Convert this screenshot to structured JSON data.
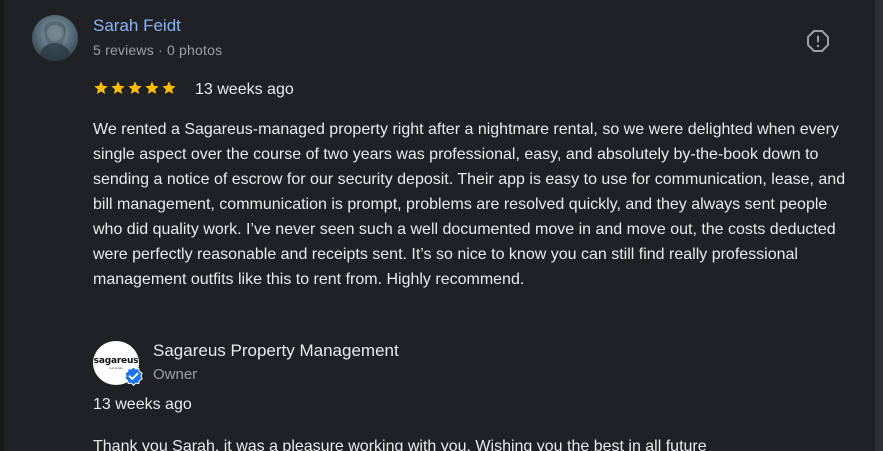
{
  "review": {
    "reviewer_name": "Sarah Feidt",
    "reviewer_meta": "5 reviews · 0 photos",
    "rating": 5,
    "rating_max": 5,
    "date": "13 weeks ago",
    "text": "We rented a Sagareus-managed property right after a nightmare rental, so we were delighted when every single aspect over the course of two years was professional, easy, and absolutely by-the-book down to sending a notice of escrow for our security deposit. Their app is easy to use for communication, lease, and bill management, communication is prompt, problems are resolved quickly, and they always sent people who did quality work. I’ve never seen such a well documented move in and move out, the costs deducted were perfectly reasonable and receipts sent. It’s so nice to know you can still find really professional management outfits like this to rent from. Highly recommend."
  },
  "owner_reply": {
    "logo_text": "sagareus",
    "logo_subtext": "real estate",
    "name": "Sagareus Property Management",
    "role": "Owner",
    "date": "13 weeks ago",
    "text": "Thank you Sarah, it was a pleasure working with you. Wishing you the best in all future"
  },
  "icons": {
    "report": "report-flag-icon",
    "star": "star-icon",
    "verified": "verified-badge-icon"
  },
  "colors": {
    "background": "#202124",
    "link": "#8ab4f8",
    "star": "#fbbc04",
    "text": "#e8eaed",
    "secondary_text": "#9aa0a6",
    "verified": "#1a73e8"
  }
}
